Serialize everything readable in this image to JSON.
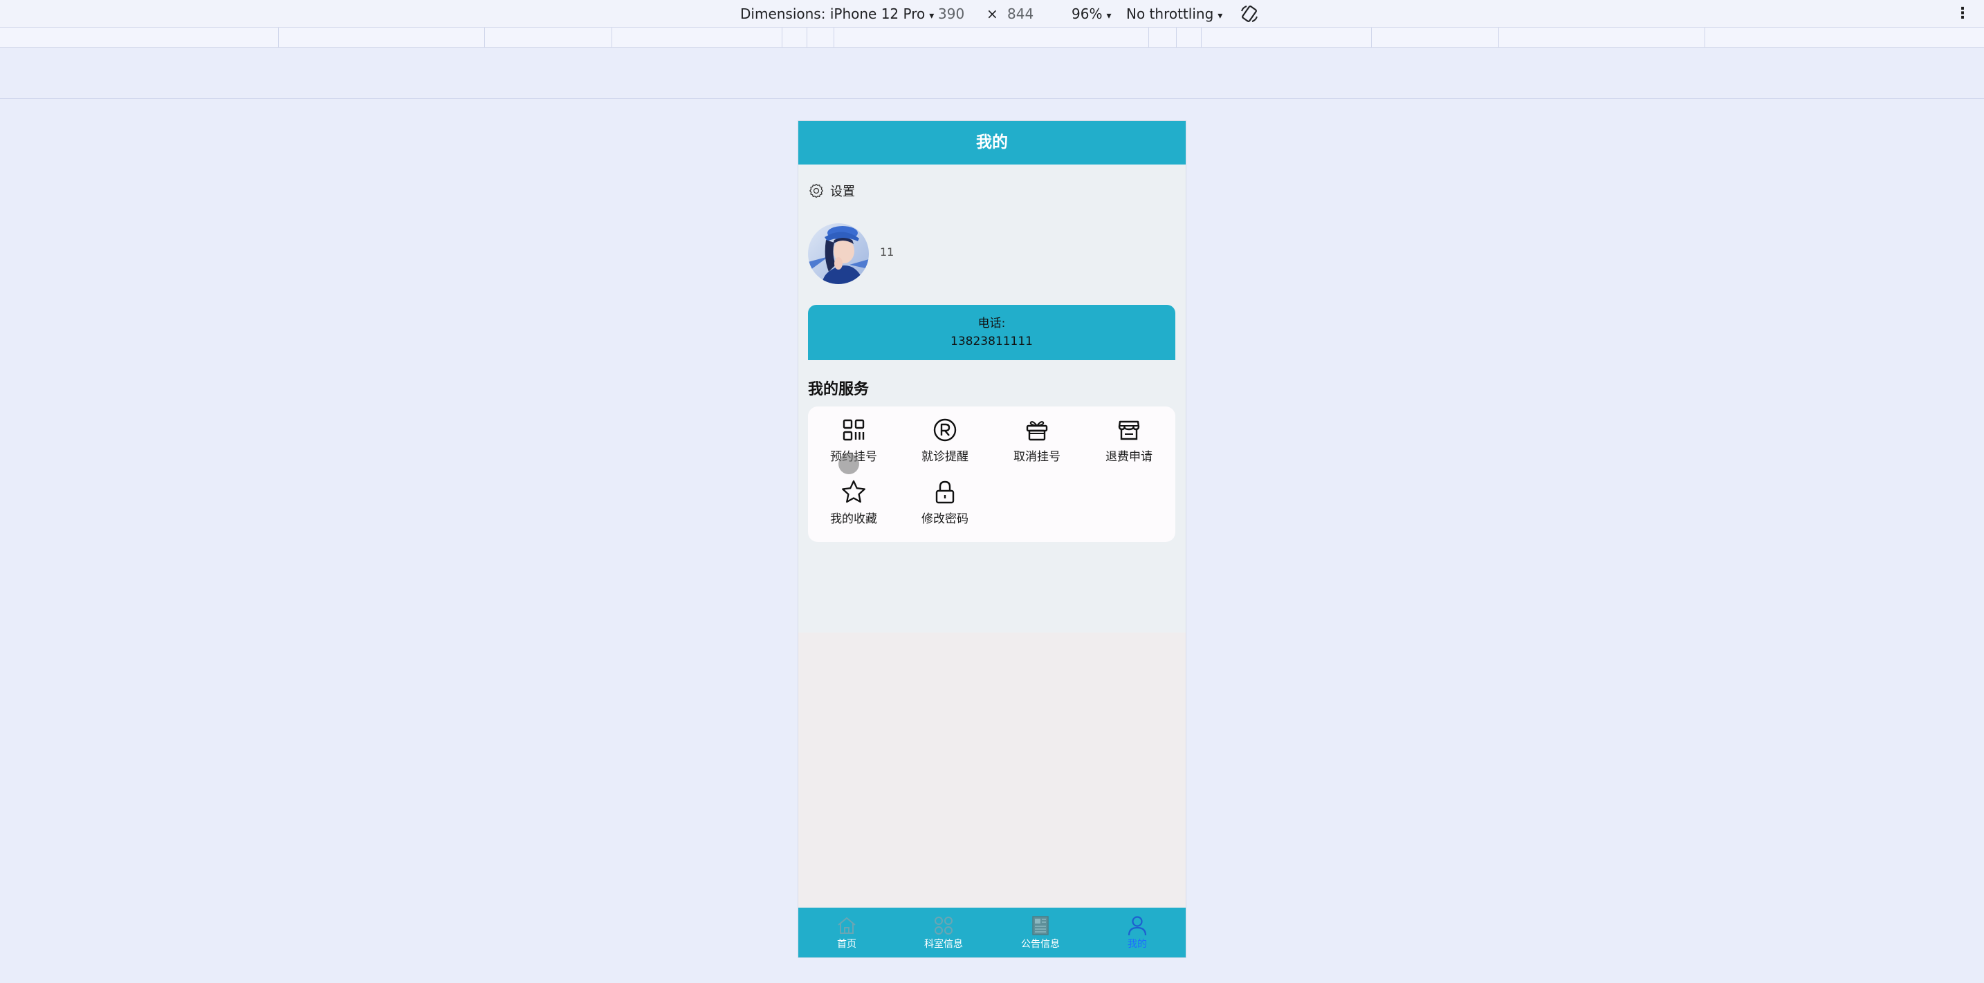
{
  "devtools": {
    "dimensions_label": "Dimensions: iPhone 12 Pro",
    "width": "390",
    "times": "×",
    "height": "844",
    "zoom": "96%",
    "throttling": "No throttling",
    "caret": "▾",
    "more": "⋮"
  },
  "page": {
    "title": "我的",
    "settings_label": "设置",
    "username": "11",
    "phone_label": "电话:",
    "phone_number": "13823811111",
    "services_title": "我的服务",
    "services": [
      {
        "label": "预约挂号",
        "icon": "qrcode-icon"
      },
      {
        "label": "就诊提醒",
        "icon": "registered-icon"
      },
      {
        "label": "取消挂号",
        "icon": "gift-icon"
      },
      {
        "label": "退费申请",
        "icon": "shop-icon"
      },
      {
        "label": "我的收藏",
        "icon": "star-icon"
      },
      {
        "label": "修改密码",
        "icon": "lock-icon"
      }
    ]
  },
  "tabbar": {
    "items": [
      {
        "label": "首页",
        "icon": "home-icon",
        "active": false
      },
      {
        "label": "科室信息",
        "icon": "grid-icon",
        "active": false
      },
      {
        "label": "公告信息",
        "icon": "news-icon",
        "active": false
      },
      {
        "label": "我的",
        "icon": "user-icon",
        "active": true
      }
    ]
  },
  "colors": {
    "primary": "#22aecb",
    "active_tab": "#1e6cff",
    "page_bg": "#e9edfa"
  }
}
